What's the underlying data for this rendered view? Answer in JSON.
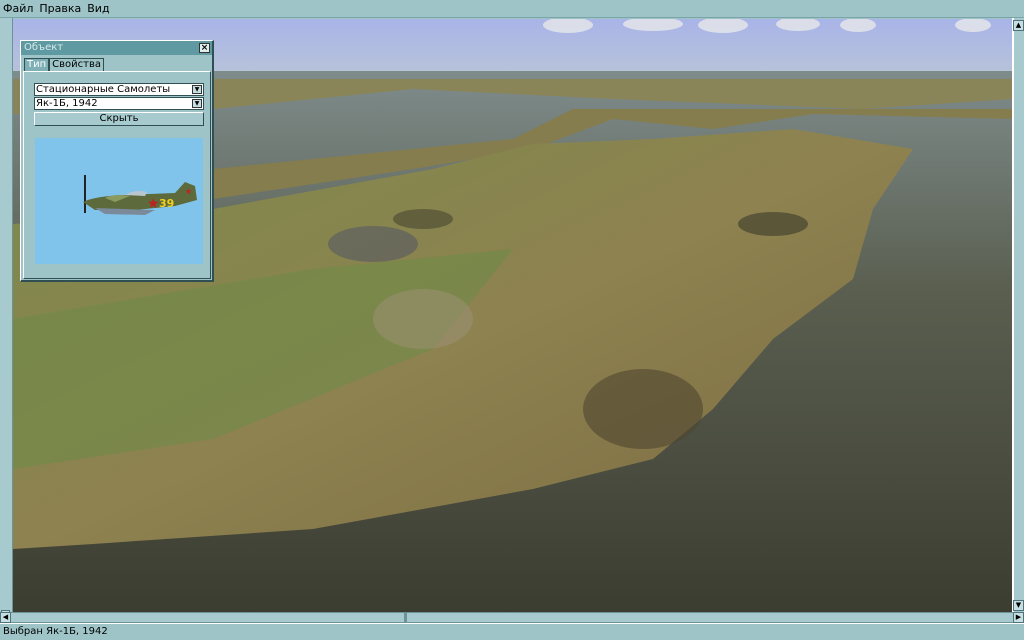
{
  "menu": {
    "items": [
      "Файл",
      "Правка",
      "Вид"
    ]
  },
  "dialog": {
    "title": "Объект",
    "tabs": [
      "Тип",
      "Свойства"
    ],
    "category_select": "Стационарные Самолеты",
    "object_select": "Як-1Б, 1942",
    "hide_button": "Скрыть",
    "preview": {
      "aircraft_number": "39"
    }
  },
  "status": {
    "text": "Выбран Як-1Б, 1942"
  },
  "colors": {
    "chrome": "#9ec4c8",
    "title_bar": "#5f9aa2",
    "preview_bg": "#80c4ec"
  }
}
